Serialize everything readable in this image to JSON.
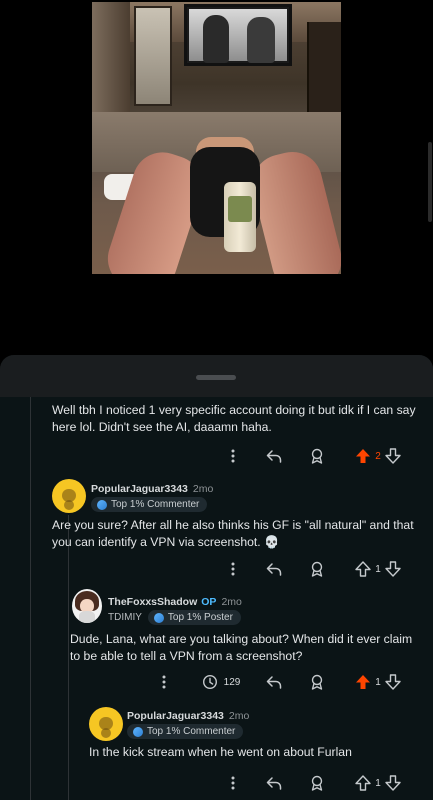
{
  "colors": {
    "upvote_active": "#ff4500",
    "op_tag": "#4fbcff",
    "avatar_yellow": "#f6c623",
    "sheet_bg": "#0b1416"
  },
  "comments": [
    {
      "body": "Well tbh I noticed 1 very specific account doing it but idk if I can say here lol. Didn't see the AI, daaamn haha.",
      "votes": "2",
      "upvoted": true
    },
    {
      "username": "PopularJaguar3343",
      "time": "2mo",
      "badge": "Top 1% Commenter",
      "body": "Are you sure? After all he also thinks his GF is \"all natural\" and that you can identify a VPN via screenshot. 💀",
      "votes": "1",
      "upvoted": false
    },
    {
      "username": "TheFoxxsShadow",
      "op_label": "OP",
      "time": "2mo",
      "flair_prefix": "TDIMIY",
      "badge": "Top 1% Poster",
      "body": "Dude, Lana, what are you talking about? When did it ever claim to be able to tell a VPN from a screenshot?",
      "awards": "129",
      "votes": "1",
      "upvoted": true
    },
    {
      "username": "PopularJaguar3343",
      "time": "2mo",
      "badge": "Top 1% Commenter",
      "body": "In the kick stream when he went on about Furlan",
      "votes": "1",
      "upvoted": false
    }
  ],
  "icons": {
    "more": "more-vertical-icon",
    "reply": "reply-arrow-icon",
    "award": "award-icon",
    "upvote": "upvote-arrow-icon",
    "downvote": "downvote-arrow-icon",
    "awards_count": "clock-award-icon"
  }
}
